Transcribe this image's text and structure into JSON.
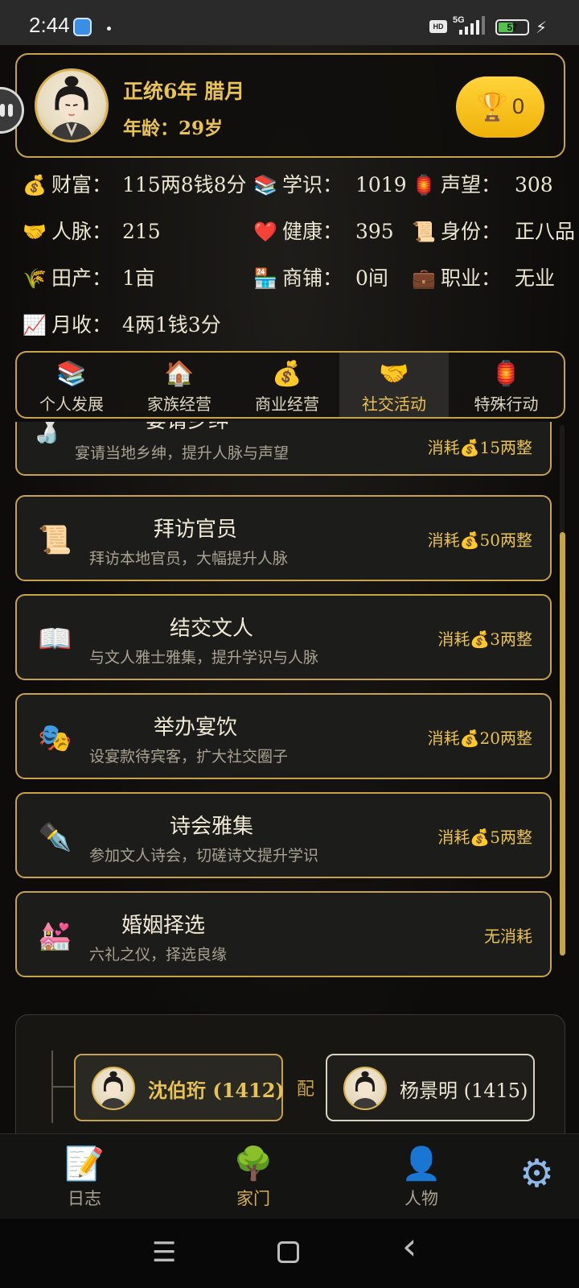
{
  "status_bar": {
    "time": "2:44",
    "network": "5G",
    "hd_label": "HD",
    "battery": "57",
    "battery_level_percent": 57
  },
  "profile": {
    "date": "正统6年 腊月",
    "age": "年龄：29岁",
    "trophy_count": "0"
  },
  "stats": [
    {
      "icon": "💰",
      "label": "财富：",
      "value": "115两8钱8分"
    },
    {
      "icon": "📚",
      "label": "学识：",
      "value": "1019"
    },
    {
      "icon": "🏮",
      "label": "声望：",
      "value": "308"
    },
    {
      "icon": "🤝",
      "label": "人脉：",
      "value": "215"
    },
    {
      "icon": "❤️",
      "label": "健康：",
      "value": "395"
    },
    {
      "icon": "📜",
      "label": "身份：",
      "value": "正八品"
    },
    {
      "icon": "🌾",
      "label": "田产：",
      "value": "1亩"
    },
    {
      "icon": "🏪",
      "label": "商铺：",
      "value": "0间"
    },
    {
      "icon": "💼",
      "label": "职业：",
      "value": "无业"
    },
    {
      "icon": "📈",
      "label": "月收：",
      "value": "4两1钱3分"
    }
  ],
  "tabs": [
    {
      "icon": "📚",
      "label": "个人发展"
    },
    {
      "icon": "🏠",
      "label": "家族经营"
    },
    {
      "icon": "💰",
      "label": "商业经营"
    },
    {
      "icon": "🤝",
      "label": "社交活动",
      "active": true
    },
    {
      "icon": "🏮",
      "label": "特殊行动"
    }
  ],
  "activities": [
    {
      "icon": "🍶",
      "title": "宴请乡绅",
      "desc": "宴请当地乡绅，提升人脉与声望",
      "cost_prefix": "消耗",
      "cost_icon": "💰",
      "cost": "15两整"
    },
    {
      "icon": "📜",
      "title": "拜访官员",
      "desc": "拜访本地官员，大幅提升人脉",
      "cost_prefix": "消耗",
      "cost_icon": "💰",
      "cost": "50两整"
    },
    {
      "icon": "📖",
      "title": "结交文人",
      "desc": "与文人雅士雅集，提升学识与人脉",
      "cost_prefix": "消耗",
      "cost_icon": "💰",
      "cost": "3两整"
    },
    {
      "icon": "🎭",
      "title": "举办宴饮",
      "desc": "设宴款待宾客，扩大社交圈子",
      "cost_prefix": "消耗",
      "cost_icon": "💰",
      "cost": "20两整"
    },
    {
      "icon": "✒️",
      "title": "诗会雅集",
      "desc": "参加文人诗会，切磋诗文提升学识",
      "cost_prefix": "消耗",
      "cost_icon": "💰",
      "cost": "5两整"
    },
    {
      "icon": "💒",
      "title": "婚姻择选",
      "desc": "六礼之仪，择选良缘",
      "cost_prefix": "",
      "cost_icon": "",
      "cost": "无消耗"
    }
  ],
  "family": {
    "self_name": "沈伯珩 (1412)",
    "spouse_label": "配",
    "spouse_name": "杨景明 (1415)"
  },
  "bottom_nav": [
    {
      "icon": "📝",
      "label": "日志"
    },
    {
      "icon": "🌳",
      "label": "家门",
      "active": true
    },
    {
      "icon": "👤",
      "label": "人物"
    }
  ],
  "settings_icon": "⚙",
  "system_nav": {
    "menu": "☰",
    "back": "‹"
  },
  "colors": {
    "accent_gold": "#c7a24a",
    "title_gold": "#e8c253",
    "trophy_yellow": "#ffd43a",
    "background": "#0c0b09"
  }
}
